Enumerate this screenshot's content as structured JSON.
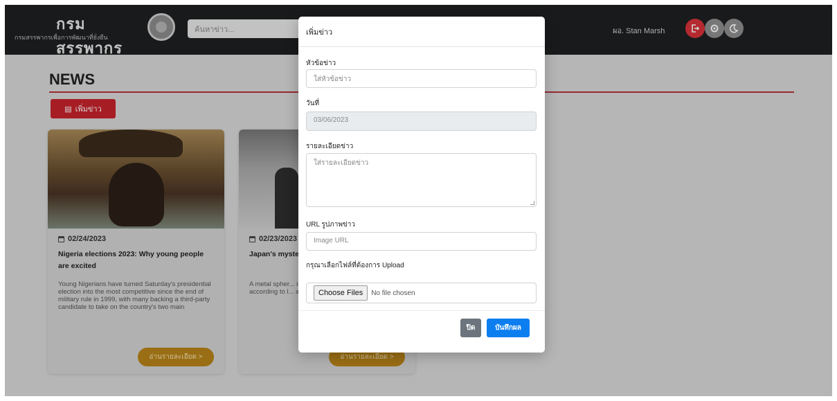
{
  "navbar": {
    "brand_title": "กรมสรรพากร",
    "brand_subtitle": "กรมสรรพากรเพื่อการพัฒนาที่ยั่งยืน",
    "search_placeholder": "ค้นหาข่าว...",
    "user_label": "ผอ. Stan Marsh",
    "icons": [
      "logout-icon",
      "settings-icon",
      "theme-toggle-icon"
    ]
  },
  "page": {
    "title": "NEWS",
    "add_button_label": "เพิ่มข่าว"
  },
  "cards": [
    {
      "date": "02/24/2023",
      "title": "Nigeria elections 2023: Why young people are excited",
      "text": "Young Nigerians have turned Saturday's presidential election into the most competitive since the end of military rule in 1999, with many backing a third-party candidate to take on the country's two main",
      "button": "อ่านรายละเอียด >"
    },
    {
      "date": "02/23/2023",
      "title": "Japan's myste... beach",
      "text": "A metal spher... in Japan, peo... widespread s... according to l... a heavy iron b...",
      "button": "อ่านรายละเอียด >"
    }
  ],
  "modal": {
    "title": "เพิ่มข่าว",
    "headline_label": "หัวข้อข่าว",
    "headline_placeholder": "ใส่หัวข้อข่าว",
    "date_label": "วันที่",
    "date_value": "03/06/2023",
    "detail_label": "รายละเอียดข่าว",
    "detail_placeholder": "ใส่รายละเอียดข่าว",
    "url_label": "URL รูปภาพข่าว",
    "url_placeholder": "Image URL",
    "upload_label": "กรุณาเลือกไฟล์ที่ต้องการ Upload",
    "choose_files": "Choose Files",
    "no_file": "No file chosen",
    "close_button": "ปิด",
    "save_button": "บันทึกผล"
  },
  "colors": {
    "navbar": "#1e1f21",
    "accent_red": "#c8232c",
    "read_more": "#b88418",
    "primary": "#0d7ef0",
    "secondary": "#6c757d"
  }
}
